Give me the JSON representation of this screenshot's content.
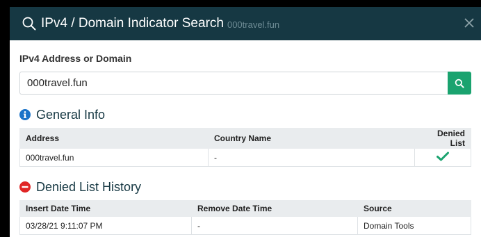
{
  "header": {
    "title": "IPv4 / Domain Indicator Search",
    "subtitle": "000travel.fun",
    "close_label": "✕"
  },
  "search": {
    "label": "IPv4 Address or Domain",
    "value": "000travel.fun"
  },
  "general_info": {
    "title": "General Info",
    "columns": [
      "Address",
      "Country Name",
      "Denied List"
    ],
    "rows": [
      {
        "address": "000travel.fun",
        "country": "-",
        "denied": true
      }
    ]
  },
  "denied_history": {
    "title": "Denied List History",
    "columns": [
      "Insert Date Time",
      "Remove Date Time",
      "Source"
    ],
    "rows": [
      {
        "insert": "03/28/21 9:11:07 PM",
        "remove": "-",
        "source": "Domain Tools"
      }
    ]
  },
  "colors": {
    "header_bg": "#163843",
    "accent_green": "#1aa36f",
    "info_blue": "#1a73c8",
    "danger_red": "#e02525"
  }
}
